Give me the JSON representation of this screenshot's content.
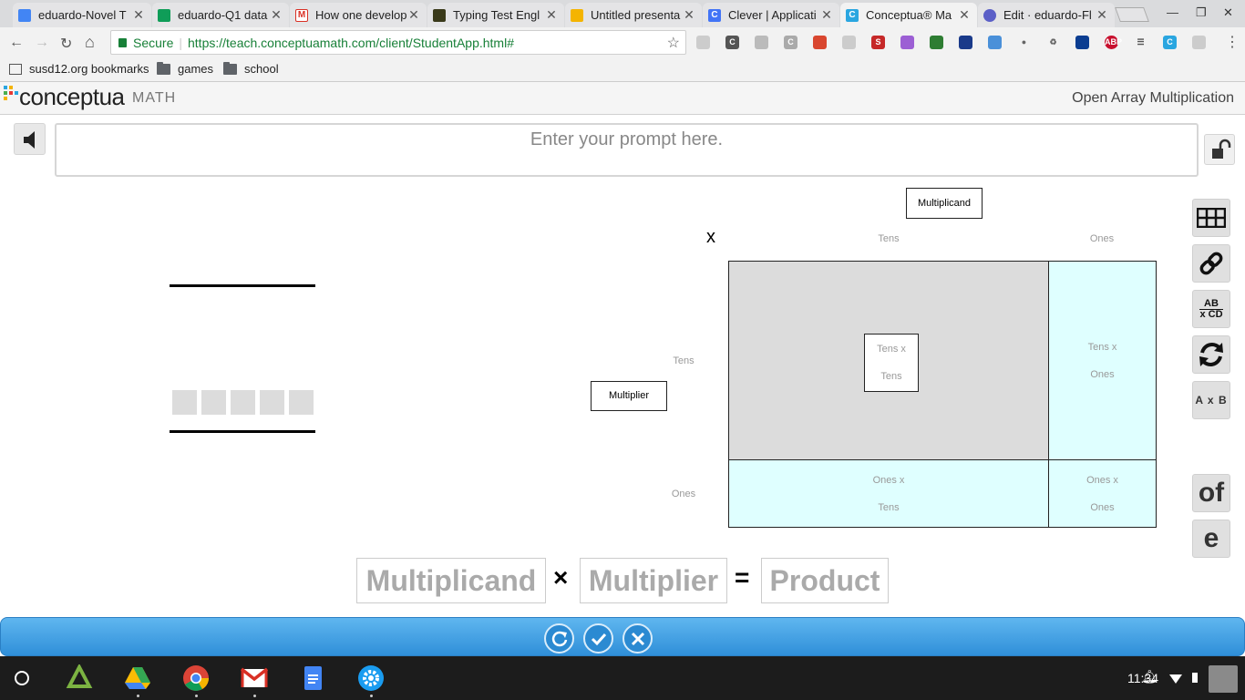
{
  "browser": {
    "tabs": [
      {
        "label": "eduardo-Novel T",
        "color": "#4285f4"
      },
      {
        "label": "eduardo-Q1 data",
        "color": "#0f9d58"
      },
      {
        "label": "How one develop",
        "color": "#d93025"
      },
      {
        "label": "Typing Test Engl",
        "color": "#3a3a1a"
      },
      {
        "label": "Untitled presenta",
        "color": "#f4b400"
      },
      {
        "label": "Clever | Applicati",
        "color": "#4274f6"
      },
      {
        "label": "Conceptua® Ma",
        "color": "#2aa6e0"
      },
      {
        "label": "Edit · eduardo-Fl",
        "color": "#5b5fc7"
      }
    ],
    "secure_label": "Secure",
    "url": "https://teach.conceptuamath.com/client/StudentApp.html#",
    "bookmarks": [
      "susd12.org bookmarks",
      "games",
      "school"
    ],
    "abp_count": "1"
  },
  "app": {
    "logo_main": "conceptua",
    "logo_sub": "MATH",
    "title": "Open Array Multiplication",
    "prompt_placeholder": "Enter your prompt here."
  },
  "workspace": {
    "times_sign": "x",
    "multiplicand_label": "Multiplicand",
    "multiplier_label": "Multiplier",
    "col_headers": [
      "Tens",
      "Ones"
    ],
    "row_headers": [
      "Tens",
      "Ones"
    ],
    "cells": {
      "tens_tens": [
        "Tens x",
        "Tens"
      ],
      "tens_ones": [
        "Tens x",
        "Ones"
      ],
      "ones_tens": [
        "Ones x",
        "Tens"
      ],
      "ones_ones": [
        "Ones x",
        "Ones"
      ]
    }
  },
  "tools": {
    "abcd_top": "AB",
    "abcd_bottom": "x CD",
    "axb": "A x B",
    "of": "of",
    "e": "e"
  },
  "equation": {
    "multiplicand": "Multiplicand",
    "times": "×",
    "multiplier": "Multiplier",
    "equals": "=",
    "product": "Product"
  },
  "system": {
    "time": "11:34"
  },
  "colors": {
    "cell_gray": "#dcdcdc",
    "cell_cyan": "#dfffff",
    "bar_blue": "#2f8fd9"
  }
}
